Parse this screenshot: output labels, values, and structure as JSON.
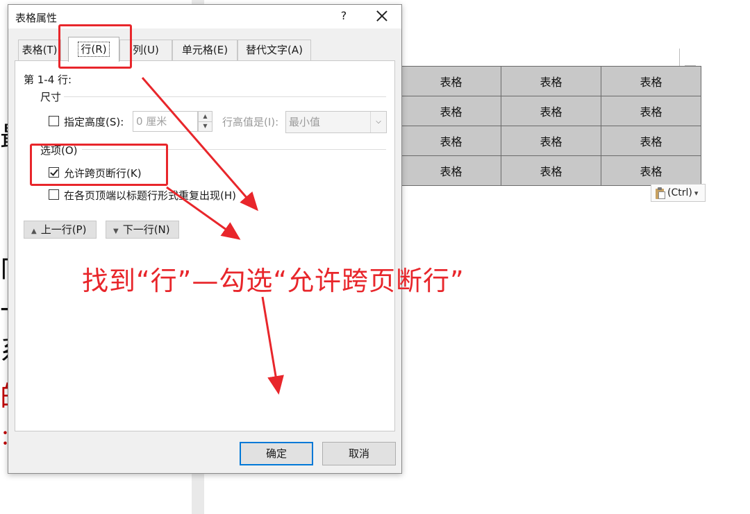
{
  "document": {
    "table": [
      [
        "表格",
        "表格",
        "表格"
      ],
      [
        "表格",
        "表格",
        "表格"
      ],
      [
        "表格",
        "表格",
        "表格"
      ],
      [
        "表格",
        "表格",
        "表格"
      ]
    ],
    "paste_options": "(Ctrl)",
    "paste_dropdown": "▾",
    "partial_chars": [
      "最",
      "向",
      "一",
      "系",
      "的",
      "："
    ]
  },
  "dialog": {
    "title": "表格属性",
    "help": "?",
    "tabs": [
      {
        "label": "表格(T)",
        "active": false
      },
      {
        "label": "行(R)",
        "active": true
      },
      {
        "label": "列(U)",
        "active": false
      },
      {
        "label": "单元格(E)",
        "active": false
      },
      {
        "label": "替代文字(A)",
        "active": false
      }
    ],
    "rows_header": "第 1-4 行:",
    "size_section": "尺寸",
    "specify_height_label": "指定高度(S):",
    "height_value": "0 厘米",
    "row_height_is_label": "行高值是(I):",
    "row_height_mode": "最小值",
    "options_section": "选项(O)",
    "allow_break_label": "允许跨页断行(K)",
    "allow_break_checked": true,
    "repeat_header_label": "在各页顶端以标题行形式重复出现(H)",
    "repeat_header_checked": false,
    "prev_row": "上一行(P)",
    "next_row": "下一行(N)",
    "ok": "确定",
    "cancel": "取消"
  },
  "annotation": {
    "text": "找到“行”—勾选“允许跨页断行”",
    "color": "#e8262b"
  }
}
